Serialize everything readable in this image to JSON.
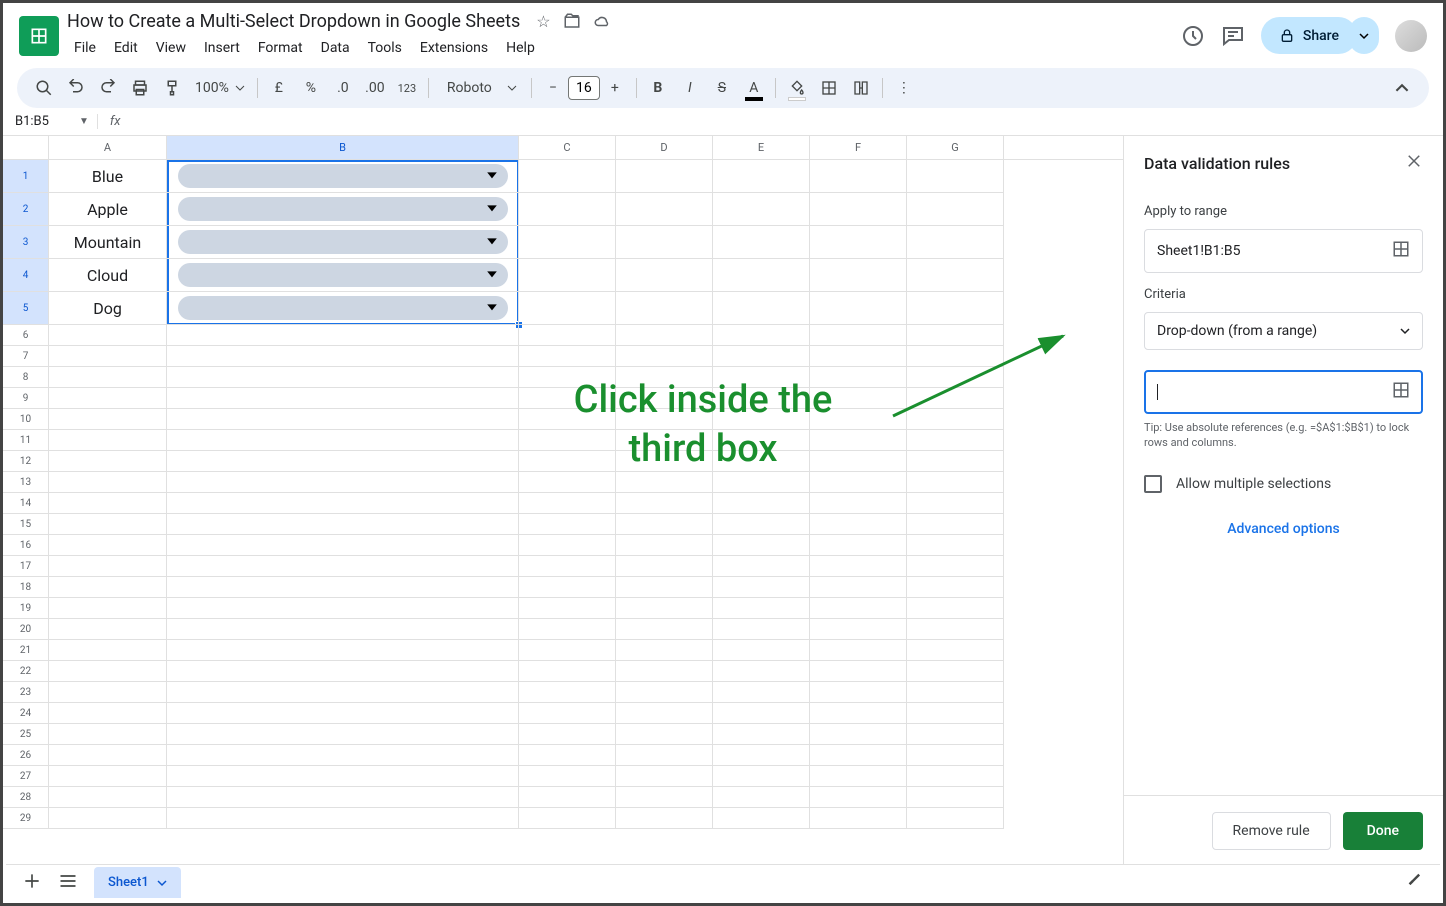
{
  "doc": {
    "title": "How to Create a Multi-Select Dropdown in Google Sheets"
  },
  "menus": [
    "File",
    "Edit",
    "View",
    "Insert",
    "Format",
    "Data",
    "Tools",
    "Extensions",
    "Help"
  ],
  "toolbar": {
    "zoom": "100%",
    "font": "Roboto",
    "fontSize": "16"
  },
  "share": {
    "label": "Share"
  },
  "namebox": "B1:B5",
  "columns": [
    "A",
    "B",
    "C",
    "D",
    "E",
    "F",
    "G"
  ],
  "colWidths": {
    "A": 118,
    "B": 352,
    "other": 97
  },
  "rowCount": 29,
  "dataRows": 5,
  "cellsA": [
    "Blue",
    "Apple",
    "Mountain",
    "Cloud",
    "Dog"
  ],
  "annotation": {
    "line1": "Click inside the",
    "line2": "third box"
  },
  "sidebar": {
    "title": "Data validation rules",
    "applyLabel": "Apply to range",
    "rangeValue": "Sheet1!B1:B5",
    "criteriaLabel": "Criteria",
    "criteriaValue": "Drop-down (from a range)",
    "rangeInputValue": "",
    "tip": "Tip: Use absolute references (e.g. =$A$1:$B$1) to lock rows and columns.",
    "allowMultiple": "Allow multiple selections",
    "advanced": "Advanced options",
    "remove": "Remove rule",
    "done": "Done"
  },
  "sheetTab": "Sheet1"
}
